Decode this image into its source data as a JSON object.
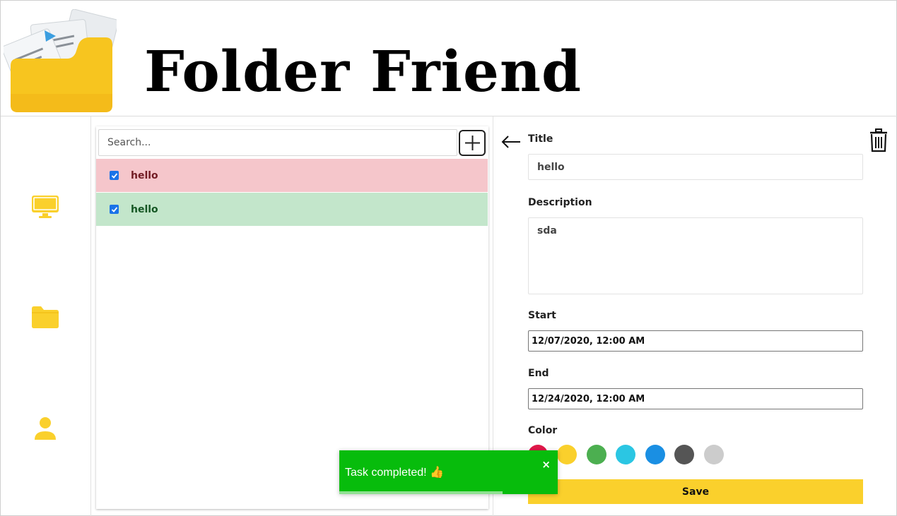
{
  "app": {
    "title": "Folder Friend"
  },
  "sidebar": {
    "items": [
      {
        "icon": "monitor-icon"
      },
      {
        "icon": "folder-icon"
      },
      {
        "icon": "user-icon"
      }
    ],
    "icon_color": "#fad02c"
  },
  "task_list": {
    "search_placeholder": "Search...",
    "add_icon": "plus-icon",
    "tasks": [
      {
        "label": "hello",
        "checked": true,
        "bg": "#f5c6cb",
        "text_color": "#721c24"
      },
      {
        "label": "hello",
        "checked": true,
        "bg": "#c3e6cb",
        "text_color": "#155724"
      }
    ]
  },
  "detail": {
    "back_icon": "arrow-left-icon",
    "delete_icon": "trash-icon",
    "title_label": "Title",
    "title_value": "hello",
    "description_label": "Description",
    "description_value": "sda",
    "start_label": "Start",
    "start_value": "12/07/2020, 12:00 AM",
    "end_label": "End",
    "end_value": "12/24/2020, 12:00 AM",
    "color_label": "Color",
    "colors": [
      "#e0194a",
      "#fad02c",
      "#4caf50",
      "#2bc6e3",
      "#1a8fe3",
      "#555555",
      "#cccccc"
    ],
    "save_label": "Save"
  },
  "toast": {
    "message": "Task completed! 👍",
    "close": "×",
    "bg": "#07bc0c"
  }
}
